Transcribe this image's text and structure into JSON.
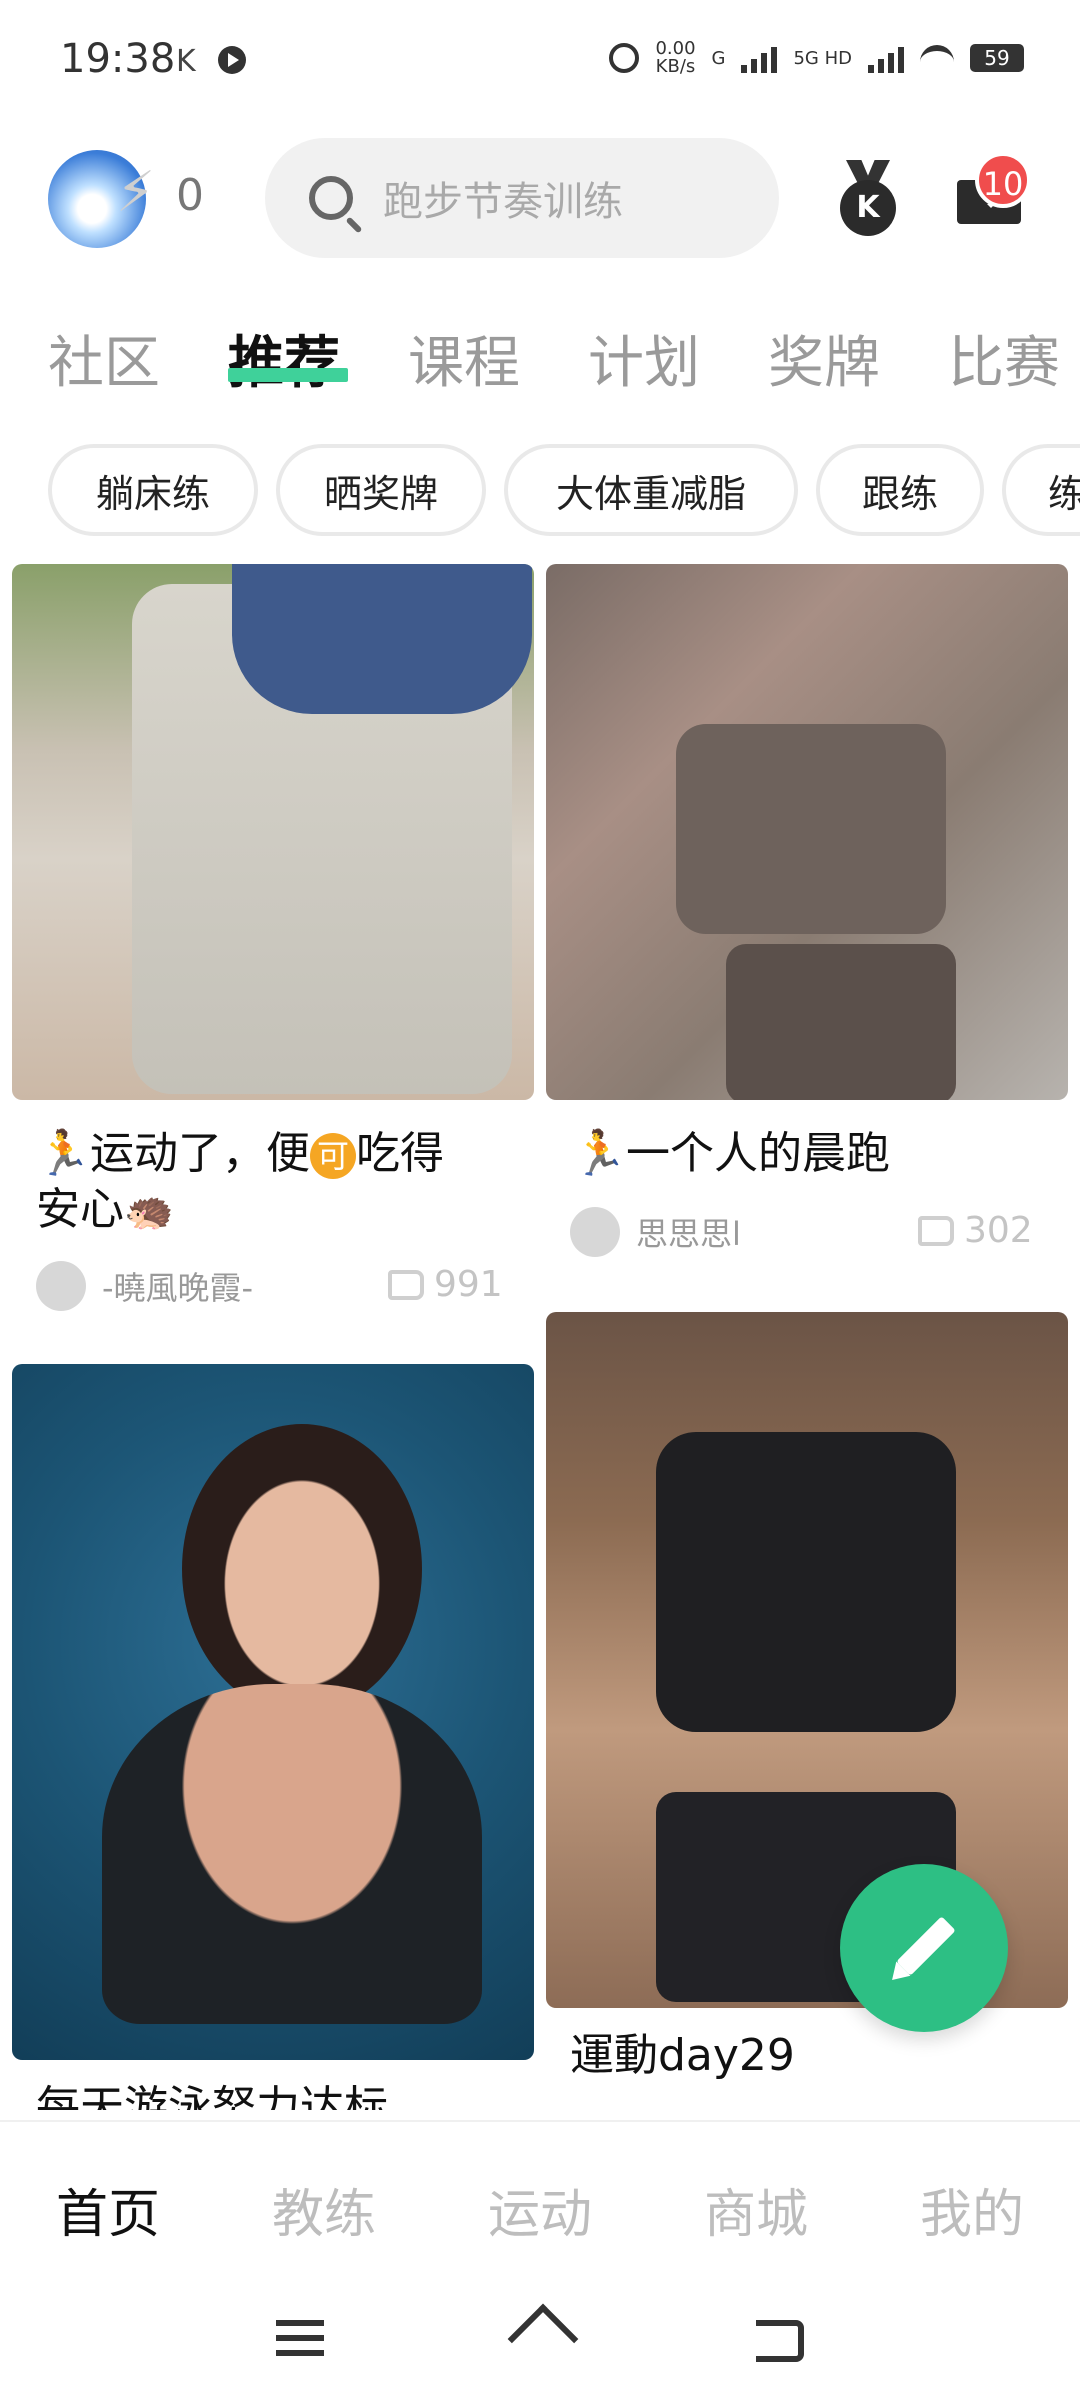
{
  "status_bar": {
    "time": "19:38",
    "k_label": "K",
    "net_speed": "0.00",
    "net_unit": "KB/s",
    "network_g": "G",
    "network_5g": "5G HD",
    "battery": "59"
  },
  "header": {
    "energy_count": "0",
    "search_placeholder": "跑步节奏训练",
    "message_badge": "10"
  },
  "tabs": [
    {
      "label": "社区",
      "active": false
    },
    {
      "label": "推荐",
      "active": true
    },
    {
      "label": "课程",
      "active": false
    },
    {
      "label": "计划",
      "active": false
    },
    {
      "label": "奖牌",
      "active": false
    },
    {
      "label": "比赛",
      "active": false
    }
  ],
  "chips": [
    "躺床练",
    "晒奖牌",
    "大体重减脂",
    "跟练",
    "练"
  ],
  "posts": [
    {
      "title_a": "运动了，便",
      "title_coin": "可",
      "title_b": "吃得",
      "title_line2": "安心",
      "title_emoji": "🦔",
      "author": "-曉風晚霞-",
      "likes": "991"
    },
    {
      "title": "一个人的晨跑",
      "author": "思思思l",
      "likes": "302"
    },
    {
      "title": "每天游泳努力达标"
    },
    {
      "title": "運動day29"
    }
  ],
  "bottom_nav": [
    {
      "label": "首页",
      "active": true
    },
    {
      "label": "教练",
      "active": false
    },
    {
      "label": "运动",
      "active": false
    },
    {
      "label": "商城",
      "active": false
    },
    {
      "label": "我的",
      "active": false
    }
  ],
  "colors": {
    "accent": "#2dbf84",
    "tab_underline": "#3fd19a",
    "badge": "#f04d4d"
  },
  "icons": {
    "search": "search-icon",
    "medal": "medal-icon",
    "mail": "mail-icon",
    "run": "run-icon",
    "like": "megaphone-like-icon",
    "fab": "pencil-icon"
  }
}
